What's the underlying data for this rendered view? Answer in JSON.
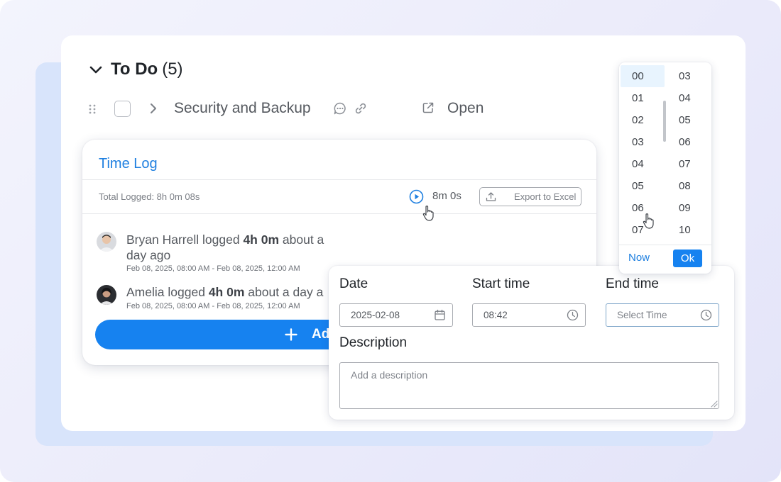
{
  "colors": {
    "accent": "#1682f0",
    "link": "#1e7fe0",
    "text_primary": "#1f2328",
    "text_secondary": "#55595f",
    "muted": "#7a7e85",
    "selected_bg": "#e8f4fe"
  },
  "group": {
    "chevron_icon": "chevron-down-icon",
    "title": "To Do",
    "count": "(5)"
  },
  "task": {
    "name": "Security and Backup",
    "status": "Open",
    "icons": [
      "drag-handle-icon",
      "checkbox",
      "chevron-right-icon",
      "comment-icon",
      "link-icon",
      "external-link-icon"
    ]
  },
  "time_log": {
    "title": "Time Log",
    "total_logged": "Total Logged: 8h 0m 08s",
    "timer_value": "8m 0s",
    "export_label": "Export to Excel",
    "entries": [
      {
        "user": "Bryan Harrell",
        "verb": "logged",
        "duration": "4h 0m",
        "when_line1": "about a",
        "when_line2": "day ago",
        "range": "Feb 08, 2025, 08:00 AM - Feb 08, 2025, 12:00 AM"
      },
      {
        "user": "Amelia",
        "verb": "logged",
        "duration": "4h 0m",
        "when_line1": "about a day a",
        "range": "Feb 08, 2025, 08:00 AM - Feb 08, 2025, 12:00 AM"
      }
    ],
    "add_button_label": "Ad"
  },
  "form": {
    "date_label": "Date",
    "date_value": "2025-02-08",
    "start_label": "Start time",
    "start_value": "08:42",
    "end_label": "End time",
    "end_placeholder": "Select Time",
    "description_label": "Description",
    "description_placeholder": "Add a description"
  },
  "time_picker": {
    "hours": [
      "00",
      "01",
      "02",
      "03",
      "04",
      "05",
      "06",
      "07"
    ],
    "minutes": [
      "03",
      "04",
      "05",
      "06",
      "07",
      "08",
      "09",
      "10"
    ],
    "selected_hour": "00",
    "now_label": "Now",
    "ok_label": "Ok"
  }
}
